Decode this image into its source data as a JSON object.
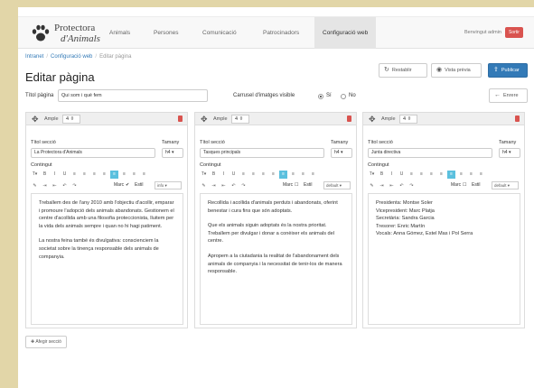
{
  "logo": {
    "line1": "Protectora",
    "line2": "d'Animals"
  },
  "nav": {
    "items": [
      {
        "label": "Animals"
      },
      {
        "label": "Persones"
      },
      {
        "label": "Comunicació"
      },
      {
        "label": "Patrocinadors"
      },
      {
        "label": "Configuració web"
      }
    ],
    "active_index": 4,
    "welcome": "Benvingut admin",
    "logout": "Sortir"
  },
  "breadcrumb": [
    "Intranet",
    "Configuració web",
    "Editar pàgina"
  ],
  "page": {
    "title": "Editar pàgina",
    "restore_label": "Restablir",
    "preview_label": "Vista prèvia",
    "publish_label": "Publicar",
    "page_title_label": "Títol pàgina",
    "page_title_value": "Qui som i què fem",
    "carousel_label": "Carrusel d'imatges visible",
    "carousel_yes": "Sí",
    "carousel_no": "No",
    "carousel_value": "Sí",
    "back_label": "Enrere",
    "add_section_label": "Afegir secció"
  },
  "labels": {
    "width": "Ample",
    "section_title": "Títol secció",
    "size": "Tamany",
    "content": "Contingut",
    "border": "Marc",
    "style": "Estil"
  },
  "sections": [
    {
      "width": "4",
      "title": "La Protectora d'Animals",
      "size": "h4",
      "border_checked": true,
      "style": "info",
      "paragraphs": [
        "Treballem des de l'any 2010 amb l'objectiu d'acollir, emparar i promoure l'adopció dels animals abandonats. Gestionem el centre d'acollida amb una filosofia proteccionista, lluitem per la vida dels animals sempre i quan no hi hagi patiment.",
        "La nostra feina també és divulgativa: conscienciem la societat sobre la tinença responsable dels animals de companyia."
      ]
    },
    {
      "width": "4",
      "title": "Tasques principals",
      "size": "h4",
      "border_checked": false,
      "style": "default",
      "paragraphs": [
        "Recollida i acollida d'animals perduts i abandonats, oferint benestar i cura fins que són adoptats.",
        "Que els animals siguin adoptats és la nostra prioritat. Treballem per divulgar i donar a conèixer els animals del centre.",
        "Apropem a la ciutadania la realitat de l'abandonament dels animals de companyia i la necessitat de tenir-los de manera responsable."
      ]
    },
    {
      "width": "4",
      "title": "Junta directiva",
      "size": "h4",
      "border_checked": false,
      "style": "default",
      "paragraphs": [
        "Presidenta: Montse Soler\nVicepresident: Marc Platja\nSecretària: Sandra Garcia\nTresorer: Enric Martín\nVocals: Anna Gómez, Estel Mas i Pol Serra"
      ]
    }
  ],
  "toolbar_row1": [
    "T▾",
    "B",
    "I",
    "U",
    "≡",
    "≡",
    "≡",
    "≡",
    "≡",
    "≡",
    "≡",
    "≡"
  ],
  "toolbar_row2": [
    "✎",
    "⇥",
    "⇤",
    "↶",
    "↷"
  ],
  "colors": {
    "accent": "#337ab7",
    "danger": "#d9534f",
    "active_tool": "#5bc0de",
    "backdrop": "#e2d6a8"
  }
}
